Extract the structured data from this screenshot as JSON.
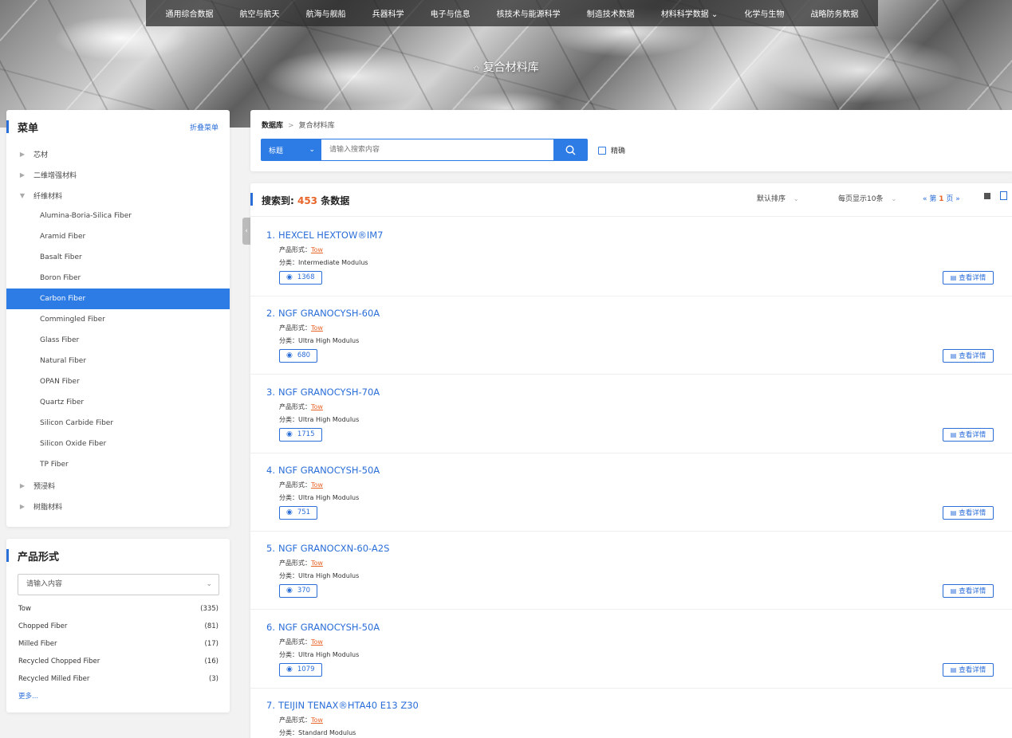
{
  "nav": {
    "items": [
      "通用综合数据",
      "航空与航天",
      "航海与舰船",
      "兵器科学",
      "电子与信息",
      "核技术与能源科学",
      "制造技术数据",
      "材料科学数据",
      "化学与生物",
      "战略防务数据"
    ],
    "dropdown_marker": "⌄"
  },
  "banner": {
    "star": "✩",
    "title": "复合材料库"
  },
  "menu": {
    "title": "菜单",
    "fold_label": "折叠菜单",
    "items": [
      {
        "label": "芯材",
        "type": "parent",
        "arrow": "▶"
      },
      {
        "label": "二维增强材料",
        "type": "parent",
        "arrow": "▶"
      },
      {
        "label": "纤维材料",
        "type": "parent",
        "arrow": "▼"
      },
      {
        "label": "Alumina-Boria-Silica Fiber",
        "type": "sub"
      },
      {
        "label": "Aramid Fiber",
        "type": "sub"
      },
      {
        "label": "Basalt Fiber",
        "type": "sub"
      },
      {
        "label": "Boron Fiber",
        "type": "sub"
      },
      {
        "label": "Carbon Fiber",
        "type": "sub",
        "active": true
      },
      {
        "label": "Commingled Fiber",
        "type": "sub"
      },
      {
        "label": "Glass Fiber",
        "type": "sub"
      },
      {
        "label": "Natural Fiber",
        "type": "sub"
      },
      {
        "label": "OPAN Fiber",
        "type": "sub"
      },
      {
        "label": "Quartz Fiber",
        "type": "sub"
      },
      {
        "label": "Silicon Carbide Fiber",
        "type": "sub"
      },
      {
        "label": "Silicon Oxide Fiber",
        "type": "sub"
      },
      {
        "label": "TP Fiber",
        "type": "sub"
      },
      {
        "label": "预浸料",
        "type": "parent",
        "arrow": "▶"
      },
      {
        "label": "树脂材料",
        "type": "parent",
        "arrow": "▶"
      }
    ]
  },
  "filter": {
    "title": "产品形式",
    "placeholder": "请输入内容",
    "chevron": "⌄",
    "options": [
      {
        "label": "Tow",
        "count": "(335)"
      },
      {
        "label": "Chopped Fiber",
        "count": "(81)"
      },
      {
        "label": "Milled Fiber",
        "count": "(17)"
      },
      {
        "label": "Recycled Chopped Fiber",
        "count": "(16)"
      },
      {
        "label": "Recycled Milled Fiber",
        "count": "(3)"
      }
    ],
    "more": "更多..."
  },
  "collapse_icon": "‹",
  "search": {
    "breadcrumb_root": "数据库",
    "breadcrumb_sep": ">",
    "breadcrumb_current": "复合材料库",
    "type_label": "标题",
    "type_chevron": "⌄",
    "placeholder": "请输入搜索内容",
    "exact_label": "精确"
  },
  "results": {
    "summary_prefix": "搜索到: ",
    "total": "453",
    "summary_suffix": " 条数据",
    "sort_label": "默认排序",
    "perpage_label": "每页显示10条",
    "chevron": "⌄",
    "pager_prefix": "« 第",
    "page": "1",
    "pager_suffix": "页 »",
    "form_label": "产品形式：",
    "class_label": "分类：",
    "detail_label": "查看详情",
    "eye_icon": "◉",
    "doc_icon": "▤",
    "items": [
      {
        "num": "1.",
        "title": "HEXCEL HEXTOW®IM7",
        "form": "Tow",
        "class": "Intermediate Modulus",
        "views": "1368"
      },
      {
        "num": "2.",
        "title": "NGF GRANOCYSH-60A",
        "form": "Tow",
        "class": "Ultra High Modulus",
        "views": "680"
      },
      {
        "num": "3.",
        "title": "NGF GRANOCYSH-70A",
        "form": "Tow",
        "class": "Ultra High Modulus",
        "views": "1715"
      },
      {
        "num": "4.",
        "title": "NGF GRANOCYSH-50A",
        "form": "Tow",
        "class": "Ultra High Modulus",
        "views": "751"
      },
      {
        "num": "5.",
        "title": "NGF GRANOCXN-60-A2S",
        "form": "Tow",
        "class": "Ultra High Modulus",
        "views": "370"
      },
      {
        "num": "6.",
        "title": "NGF GRANOCYSH-50A",
        "form": "Tow",
        "class": "Ultra High Modulus",
        "views": "1079"
      },
      {
        "num": "7.",
        "title": "TEIJIN TENAX®HTA40 E13 Z30",
        "form": "Tow",
        "class": "Standard Modulus",
        "views": ""
      }
    ]
  },
  "colors": {
    "accent": "#2d7be4",
    "highlight": "#e8652a"
  }
}
